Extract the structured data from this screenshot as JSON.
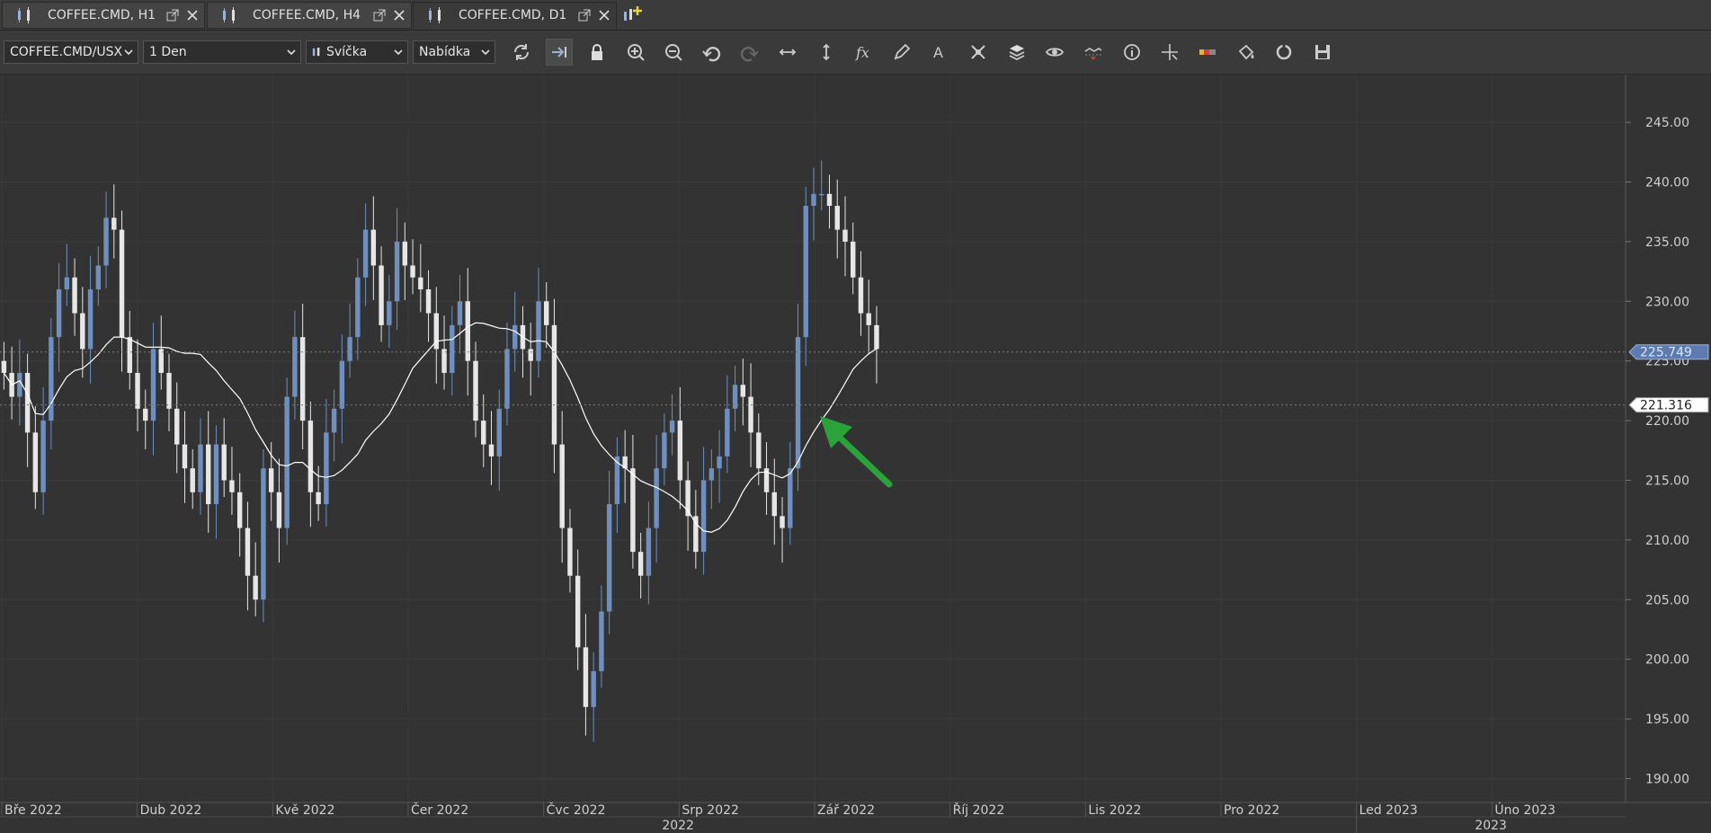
{
  "tabs": [
    {
      "label": "COFFEE.CMD, H1",
      "active": false
    },
    {
      "label": "COFFEE.CMD, H4",
      "active": false
    },
    {
      "label": "COFFEE.CMD, D1",
      "active": true
    }
  ],
  "toolbar": {
    "instrument": "COFFEE.CMD/USX",
    "period": "1 Den",
    "chart_type": "Svíčka",
    "price_side": "Nabídka",
    "icons": [
      "refresh-icon",
      "auto-shift-icon",
      "lock-icon",
      "zoom-in-icon",
      "zoom-out-icon",
      "undo-icon",
      "redo-icon",
      "horizontal-scale-icon",
      "vertical-scale-icon",
      "indicators-icon",
      "pencil-icon",
      "text-icon",
      "drawing-tools-icon",
      "layers-icon",
      "eye-icon",
      "signal-icon",
      "info-icon",
      "crosshair-icon",
      "ruler-icon",
      "theme-icon",
      "reload-icon",
      "save-icon"
    ]
  },
  "chart_data": {
    "type": "candlestick",
    "background": "#333333",
    "bull_color": "#6f8fbf",
    "bear_color": "#e6e6e6",
    "ylim": [
      188,
      249
    ],
    "y_ticks": [
      "245.00",
      "240.00",
      "235.00",
      "230.00",
      "225.00",
      "220.00",
      "215.00",
      "210.00",
      "205.00",
      "200.00",
      "195.00",
      "190.00"
    ],
    "x_labels": [
      "Bře 2022",
      "Dub 2022",
      "Kvě 2022",
      "Čer 2022",
      "Čvc 2022",
      "Srp 2022",
      "Zář 2022",
      "Říj 2022",
      "Lis 2022",
      "Pro 2022",
      "Led 2023",
      "Úno 2023"
    ],
    "x_years": [
      "2022",
      "2023"
    ],
    "last_price": "225.749",
    "ma_value": "221.316",
    "ma_color": "#ffffff",
    "arrow_color": "#2aa33a",
    "close_series": [
      224,
      222,
      224,
      219,
      214,
      220,
      227,
      231,
      232,
      229,
      226,
      231,
      233,
      237,
      236,
      227,
      224,
      221,
      220,
      226,
      224,
      221,
      218,
      216,
      214,
      218,
      213,
      218,
      215,
      214,
      211,
      207,
      205,
      216,
      214,
      211,
      222,
      227,
      220,
      214,
      213,
      219,
      221,
      225,
      227,
      232,
      236,
      233,
      228,
      230,
      235,
      233,
      232,
      231,
      229,
      226,
      224,
      228,
      230,
      225,
      220,
      218,
      217,
      221,
      226,
      228,
      226,
      225,
      230,
      228,
      218,
      211,
      207,
      201,
      196,
      199,
      204,
      213,
      217,
      216,
      209,
      207,
      211,
      216,
      219,
      220,
      215,
      212,
      209,
      215,
      216,
      217,
      221,
      223,
      222,
      219,
      216,
      214,
      212,
      211,
      216,
      227,
      238,
      239,
      239,
      238,
      236,
      235,
      232,
      229,
      228,
      226
    ]
  }
}
